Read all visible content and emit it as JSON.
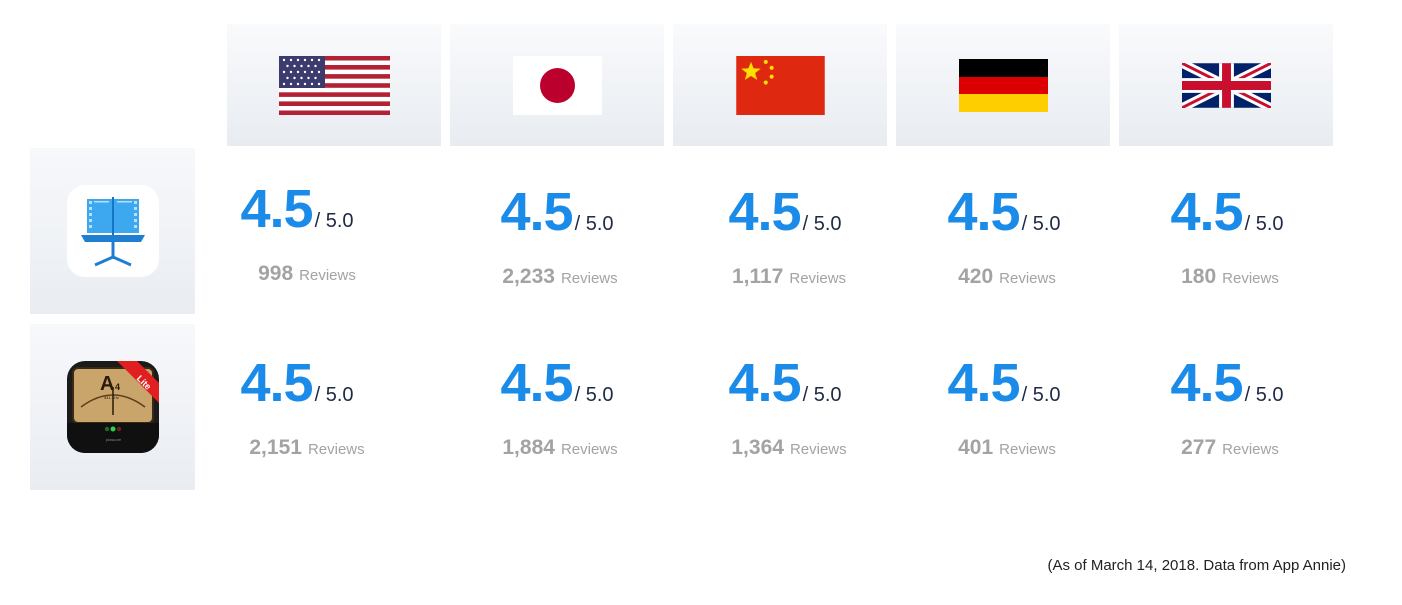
{
  "countries": [
    {
      "name": "us-flag-icon"
    },
    {
      "name": "jp-flag-icon"
    },
    {
      "name": "cn-flag-icon"
    },
    {
      "name": "de-flag-icon"
    },
    {
      "name": "uk-flag-icon"
    }
  ],
  "apps": [
    {
      "icon": "music-stand-icon",
      "ratings": [
        {
          "score": "4.5",
          "out_of": "/ 5.0",
          "count": "998",
          "label": "Reviews"
        },
        {
          "score": "4.5",
          "out_of": "/ 5.0",
          "count": "2,233",
          "label": "Reviews"
        },
        {
          "score": "4.5",
          "out_of": "/ 5.0",
          "count": "1,117",
          "label": "Reviews"
        },
        {
          "score": "4.5",
          "out_of": "/ 5.0",
          "count": "420",
          "label": "Reviews"
        },
        {
          "score": "4.5",
          "out_of": "/ 5.0",
          "count": "180",
          "label": "Reviews"
        }
      ]
    },
    {
      "icon": "tuner-lite-icon",
      "icon_text": {
        "note": "A",
        "octave": "4",
        "freq": "441.1Hz",
        "ribbon": "Lite",
        "brand": "piascore"
      },
      "ratings": [
        {
          "score": "4.5",
          "out_of": "/ 5.0",
          "count": "2,151",
          "label": "Reviews"
        },
        {
          "score": "4.5",
          "out_of": "/ 5.0",
          "count": "1,884",
          "label": "Reviews"
        },
        {
          "score": "4.5",
          "out_of": "/ 5.0",
          "count": "1,364",
          "label": "Reviews"
        },
        {
          "score": "4.5",
          "out_of": "/ 5.0",
          "count": "401",
          "label": "Reviews"
        },
        {
          "score": "4.5",
          "out_of": "/ 5.0",
          "count": "277",
          "label": "Reviews"
        }
      ]
    }
  ],
  "footnote": "(As of March 14, 2018. Data from App Annie)",
  "colors": {
    "accent": "#1a8be8",
    "muted": "#a3a3a3",
    "dark": "#1e2a44"
  }
}
